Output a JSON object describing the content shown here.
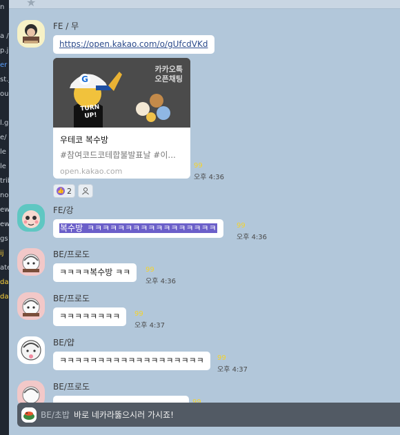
{
  "left_panel_fragments": [
    {
      "text": "n",
      "cls": ""
    },
    {
      "text": " ",
      "cls": ""
    },
    {
      "text": "a /",
      "cls": ""
    },
    {
      "text": "p.j",
      "cls": ""
    },
    {
      "text": "er",
      "cls": "hl"
    },
    {
      "text": "st.j",
      "cls": ""
    },
    {
      "text": "ou",
      "cls": ""
    },
    {
      "text": " ",
      "cls": ""
    },
    {
      "text": "l.g",
      "cls": ""
    },
    {
      "text": "e/",
      "cls": ""
    },
    {
      "text": "le",
      "cls": ""
    },
    {
      "text": "le",
      "cls": ""
    },
    {
      "text": "trib",
      "cls": ""
    },
    {
      "text": "no",
      "cls": ""
    },
    {
      "text": "ew",
      "cls": ""
    },
    {
      "text": "ew",
      "cls": ""
    },
    {
      "text": "gs",
      "cls": ""
    },
    {
      "text": "ij",
      "cls": "warn"
    },
    {
      "text": "ate",
      "cls": ""
    },
    {
      "text": "dar",
      "cls": "warn"
    },
    {
      "text": "dar",
      "cls": "warn"
    }
  ],
  "messages": {
    "m1": {
      "sender": "FE / 무",
      "link": "https://open.kakao.com/o/gUfcdVKd",
      "card": {
        "tag_line1": "카카오톡",
        "tag_line2": "오픈채팅",
        "cap_letter": "G",
        "shirt": "TURN UP!",
        "title": "우테코 복수방",
        "desc": "#참여코드코테합불발표날 #이...",
        "host": "open.kakao.com"
      },
      "unread": "99",
      "time": "오후 4:36",
      "reactions": {
        "like_count": "2"
      }
    },
    "m2": {
      "sender": "FE/강",
      "text_prefix": "복수방 ",
      "text_selected": "ㅋㅋㅋㅋㅋㅋㅋㅋㅋㅋㅋㅋㅋㅋㅋㅋㅋ",
      "unread": "99",
      "time": "오후 4:36"
    },
    "m3": {
      "sender": "BE/프로도",
      "text": "ㅋㅋㅋㅋ복수방 ㅋㅋ",
      "unread": "99",
      "time": "오후 4:36"
    },
    "m4": {
      "sender": "BE/프로도",
      "text": "ㅋㅋㅋㅋㅋㅋㅋㅋ",
      "unread": "99",
      "time": "오후 4:37"
    },
    "m5": {
      "sender": "BE/얍",
      "text": "ㅋㅋㅋㅋㅋㅋㅋㅋㅋㅋㅋㅋㅋㅋㅋㅋㅋㅋㅋ",
      "unread": "99",
      "time": "오후 4:37"
    },
    "m6": {
      "sender": "BE/프로도",
      "unread": "99"
    }
  },
  "notice": {
    "name": "BE/초밥",
    "text": "바로 네카라뚫으시러 가시죠!"
  },
  "icons": {
    "star": "star-icon",
    "like": "thumbs-up-icon",
    "person": "person-icon"
  },
  "colors": {
    "background": "#b2c7da",
    "bubble": "#ffffff",
    "unread": "#f5d32b",
    "selection": "#6b5fc9",
    "notice_bar": "#525a64"
  }
}
